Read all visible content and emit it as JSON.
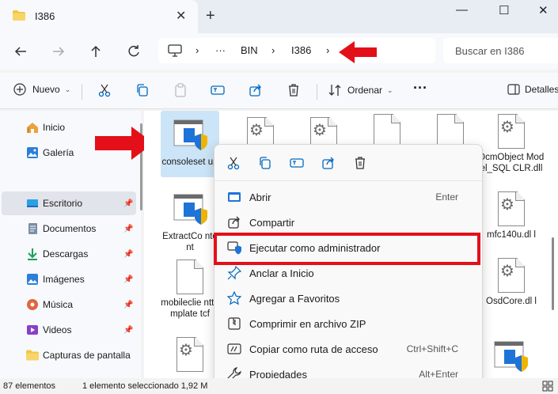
{
  "tab": {
    "title": "I386",
    "close": "✕",
    "add": "+"
  },
  "window_controls": {
    "minimize": "—",
    "maximize": "☐",
    "close": "✕"
  },
  "address": {
    "more": "···",
    "crumbs": [
      "BIN",
      "I386"
    ],
    "sep": "›"
  },
  "search": {
    "placeholder": "Buscar en I386"
  },
  "toolbar": {
    "new_label": "Nuevo",
    "sort_label": "Ordenar",
    "more": "···",
    "details_label": "Detalles"
  },
  "sidebar": {
    "items": [
      {
        "label": "Inicio"
      },
      {
        "label": "Galería"
      },
      {
        "label": "Escritorio",
        "pinned": true
      },
      {
        "label": "Documentos",
        "pinned": true
      },
      {
        "label": "Descargas",
        "pinned": true
      },
      {
        "label": "Imágenes",
        "pinned": true
      },
      {
        "label": "Música",
        "pinned": true
      },
      {
        "label": "Videos",
        "pinned": true
      },
      {
        "label": "Capturas de pantalla"
      }
    ]
  },
  "files": [
    {
      "label": "consoleset up",
      "type": "app"
    },
    {
      "label": "DcmObject Model_SQL CLR.dll",
      "type": "gear"
    },
    {
      "label": "ExtractCo ntent",
      "type": "app"
    },
    {
      "label": "mfc140u.dl l",
      "type": "gear"
    },
    {
      "label": "mobileclie nttemplate tcf",
      "type": "doc"
    },
    {
      "label": "OsdCore.dl l",
      "type": "gear"
    }
  ],
  "context_menu": {
    "items": [
      {
        "label": "Abrir",
        "shortcut": "Enter"
      },
      {
        "label": "Compartir",
        "shortcut": ""
      },
      {
        "label": "Ejecutar como administrador",
        "shortcut": ""
      },
      {
        "label": "Anclar a Inicio",
        "shortcut": ""
      },
      {
        "label": "Agregar a Favoritos",
        "shortcut": ""
      },
      {
        "label": "Comprimir en archivo ZIP",
        "shortcut": ""
      },
      {
        "label": "Copiar como ruta de acceso",
        "shortcut": "Ctrl+Shift+C"
      },
      {
        "label": "Propiedades",
        "shortcut": "Alt+Enter"
      }
    ]
  },
  "status": {
    "count": "87 elementos",
    "selection": "1 elemento seleccionado  1,92 M"
  },
  "colors": {
    "accent": "#0067c0",
    "highlight": "#e3101a",
    "folder": "#f2c744"
  }
}
